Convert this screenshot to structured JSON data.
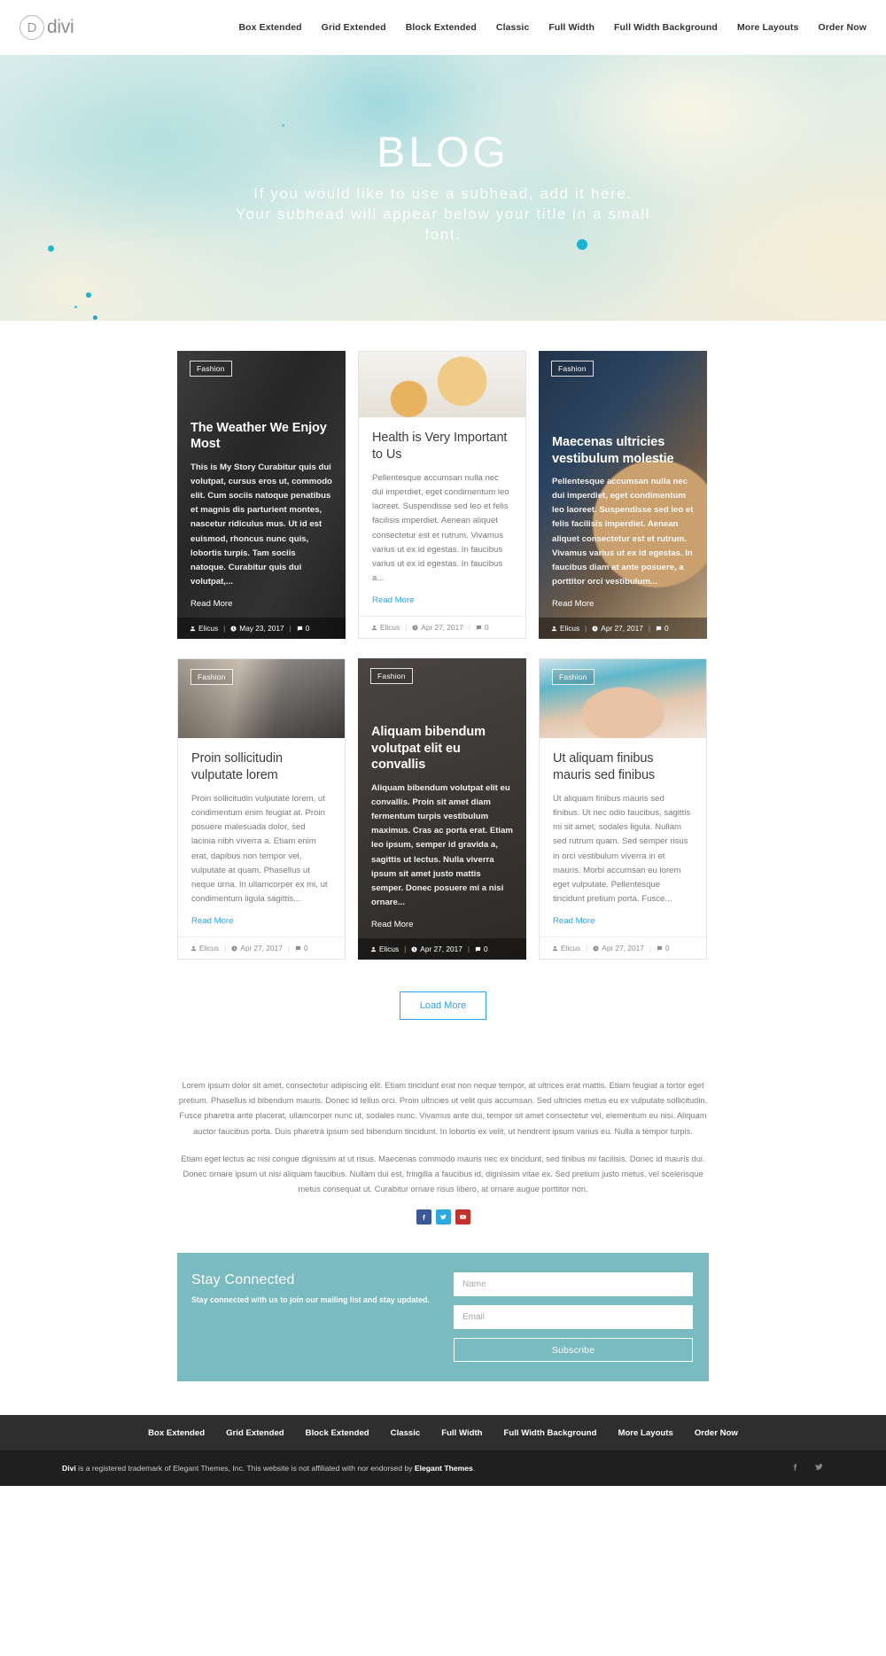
{
  "header": {
    "logo_letter": "D",
    "logo_text": "divi",
    "nav": [
      {
        "label": "Box Extended"
      },
      {
        "label": "Grid Extended"
      },
      {
        "label": "Block Extended"
      },
      {
        "label": "Classic"
      },
      {
        "label": "Full Width"
      },
      {
        "label": "Full Width Background"
      },
      {
        "label": "More Layouts"
      },
      {
        "label": "Order Now"
      }
    ]
  },
  "hero": {
    "title": "BLOG",
    "subtitle": "If you would like to use a subhead, add it here. Your subhead will appear below your title in a small font."
  },
  "blog": {
    "posts": [
      {
        "style": "overlay",
        "image": "img-street",
        "category": "Fashion",
        "title": "The Weather We Enjoy Most",
        "excerpt": "This is My Story Curabitur quis dui volutpat, cursus eros ut, commodo elit. Cum sociis natoque penatibus et magnis dis parturient montes, nascetur ridiculus mus. Ut id est euismod, rhoncus nunc quis, lobortis turpis. Tam sociis natoque. Curabitur quis dui volutpat,...",
        "read_more": "Read More",
        "author": "Elicus",
        "date": "May 23, 2017",
        "comments": "0"
      },
      {
        "style": "light",
        "image": "img-teddy",
        "category": "",
        "title": "Health is Very Important to Us",
        "excerpt": "Pellentesque accumsan nulla nec dui imperdiet, eget condimentum leo laoreet. Suspendisse sed leo et felis facilisis imperdiet. Aenean aliquet consectetur est et rutrum. Vivamus varius ut ex id egestas. In faucibus varius ut ex id egestas. In faucibus a...",
        "read_more": "Read More",
        "author": "Elicus",
        "date": "Apr 27, 2017",
        "comments": "0"
      },
      {
        "style": "overlay",
        "image": "img-baby",
        "category": "Fashion",
        "title": "Maecenas ultricies vestibulum molestie",
        "excerpt": "Pellentesque accumsan nulla nec dui imperdiet, eget condimentum leo laoreet. Suspendisse sed leo et felis facilisis imperdiet. Aenean aliquet consectetur est et rutrum. Vivamus varius ut ex id egestas. In faucibus diam at ante posuere, a porttitor orci vestibulum...",
        "read_more": "Read More",
        "author": "Elicus",
        "date": "Apr 27, 2017",
        "comments": "0"
      },
      {
        "style": "light",
        "image": "img-garage",
        "category": "Fashion",
        "title": "Proin sollicitudin vulputate lorem",
        "excerpt": "Proin sollicitudin vulputate lorem, ut condimentum enim feugiat at. Proin posuere malesuada dolor, sed lacinia nibh viverra a. Etiam enim erat, dapibus non tempor vel, vulputate at quam. Phasellus ut neque urna. In ullamcorper ex mi, ut condimentum ligula sagittis...",
        "read_more": "Read More",
        "author": "Elicus",
        "date": "Apr 27, 2017",
        "comments": "0"
      },
      {
        "style": "overlay",
        "image": "img-dark-room",
        "category": "Fashion",
        "title": "Aliquam bibendum volutpat elit eu convallis",
        "excerpt": "Aliquam bibendum volutpat elit eu convallis. Proin sit amet diam fermentum turpis vestibulum maximus. Cras ac porta erat. Etiam leo ipsum, semper id gravida a, sagittis ut lectus. Nulla viverra ipsum sit amet justo mattis semper. Donec posuere mi a nisi ornare...",
        "read_more": "Read More",
        "author": "Elicus",
        "date": "Apr 27, 2017",
        "comments": "0"
      },
      {
        "style": "light",
        "image": "img-hands",
        "category": "Fashion",
        "title": "Ut aliquam finibus mauris sed finibus",
        "excerpt": "Ut aliquam finibus mauris sed finibus. Ut nec odio faucibus, sagittis mi sit amet, sodales ligula. Nullam sed rutrum quam. Sed semper risus in orci vestibulum viverra in et mauris. Morbi accumsan eu lorem eget vulputate. Pellentesque tincidunt pretium porta. Fusce...",
        "read_more": "Read More",
        "author": "Elicus",
        "date": "Apr 27, 2017",
        "comments": "0"
      }
    ],
    "load_more": "Load More"
  },
  "content": {
    "paragraph1": "Lorem ipsum dolor sit amet, consectetur adipiscing elit. Etiam tincidunt erat non neque tempor, at ultrices erat mattis. Etiam feugiat a tortor eget pretium. Phasellus id bibendum mauris. Donec id tellus orci. Proin ultricies ut velit quis accumsan. Sed ultricies metus eu ex vulputate sollicitudin. Fusce pharetra ante placerat, ullamcorper nunc ut, sodales nunc. Vivamus ante dui, tempor sit amet consectetur vel, elementum eu nisi. Aliquam auctor faucibus porta. Duis pharetra ipsum sed bibendum tincidunt. In lobortis ex velit, ut hendrerit ipsum varius eu. Nulla a tempor turpis.",
    "paragraph2": "Etiam eget lectus ac nisi congue dignissim at ut risus. Maecenas commodo mauris nec ex tincidunt, sed finibus mi facilisis. Donec id mauris dui. Donec ornare ipsum ut nisi aliquam faucibus. Nullam dui est, fringilla a faucibus id, dignissim vitae ex. Sed pretium justo metus, vel scelerisque metus consequat ut. Curabitur ornare risus libero, at ornare augue porttitor non.",
    "socials": [
      {
        "name": "facebook",
        "color": "#3b5998"
      },
      {
        "name": "twitter",
        "color": "#2ca8e0"
      },
      {
        "name": "youtube",
        "color": "#c4302b"
      }
    ]
  },
  "newsletter": {
    "title": "Stay Connected",
    "description": "Stay connected with us to join our mailing list and stay updated.",
    "name_placeholder": "Name",
    "email_placeholder": "Email",
    "name_value": "",
    "email_value": "",
    "subscribe_label": "Subscribe",
    "background": "#79bbc0"
  },
  "footer": {
    "nav": [
      {
        "label": "Box Extended"
      },
      {
        "label": "Grid Extended"
      },
      {
        "label": "Block Extended"
      },
      {
        "label": "Classic"
      },
      {
        "label": "Full Width"
      },
      {
        "label": "Full Width Background"
      },
      {
        "label": "More Layouts"
      },
      {
        "label": "Order Now"
      }
    ],
    "copyright_brand": "Divi",
    "copyright_middle": " is a registered trademark of Elegant Themes, Inc. This website is not affiliated with nor endorsed by ",
    "copyright_brand2": "Elegant Themes",
    "copyright_end": "."
  }
}
